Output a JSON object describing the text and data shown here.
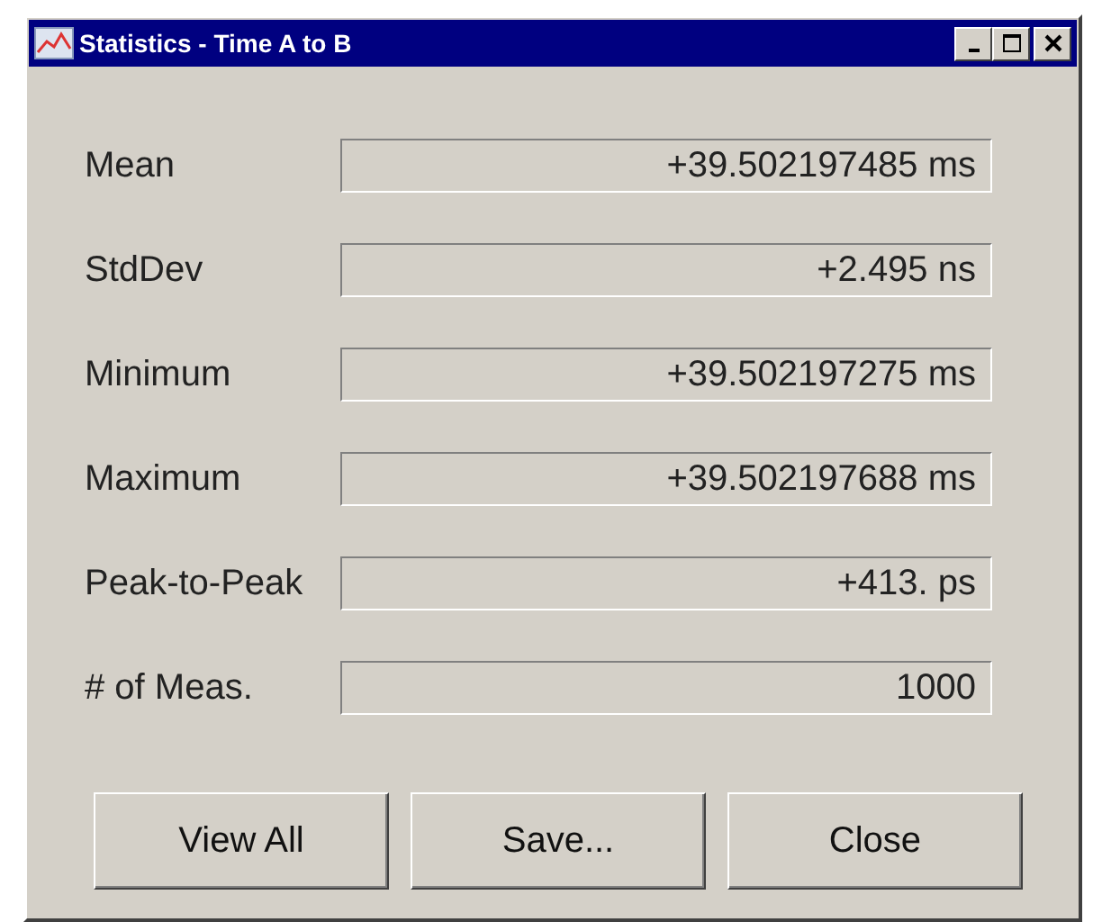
{
  "window": {
    "title": "Statistics - Time A to B"
  },
  "title_buttons": [
    {
      "kind": "minimize"
    },
    {
      "kind": "maximize"
    },
    {
      "kind": "close"
    }
  ],
  "fields": [
    {
      "label": "Mean",
      "value": "+39.502197485 ms"
    },
    {
      "label": "StdDev",
      "value": "+2.495 ns"
    },
    {
      "label": "Minimum",
      "value": "+39.502197275 ms"
    },
    {
      "label": "Maximum",
      "value": "+39.502197688 ms"
    },
    {
      "label": "Peak-to-Peak",
      "value": "+413. ps"
    },
    {
      "label": "# of Meas.",
      "value": "1000"
    }
  ],
  "buttons": [
    "View All",
    "Save...",
    "Close"
  ]
}
